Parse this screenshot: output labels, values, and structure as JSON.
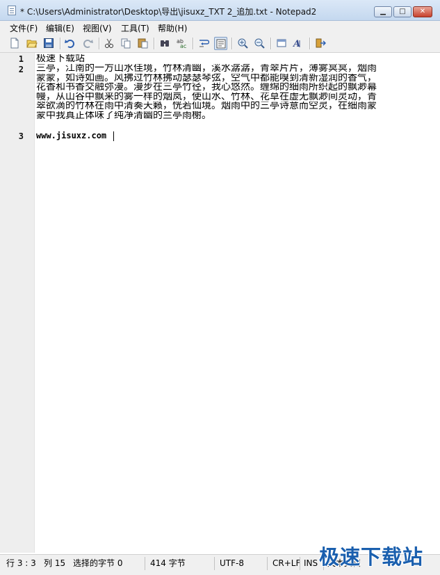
{
  "window": {
    "title": "* C:\\Users\\Administrator\\Desktop\\导出\\jisuxz_TXT 2_追加.txt - Notepad2",
    "minimize_glyph": "▁",
    "maximize_glyph": "□",
    "close_glyph": "✕"
  },
  "menu": {
    "items": [
      "文件(F)",
      "编辑(E)",
      "视图(V)",
      "工具(T)",
      "帮助(H)"
    ]
  },
  "toolbar": {
    "buttons": [
      {
        "icon": "new-file-icon"
      },
      {
        "icon": "open-folder-icon"
      },
      {
        "icon": "save-icon"
      },
      {
        "icon": "undo-icon"
      },
      {
        "icon": "redo-icon"
      },
      {
        "icon": "cut-icon"
      },
      {
        "icon": "copy-icon"
      },
      {
        "icon": "paste-icon"
      },
      {
        "icon": "find-icon"
      },
      {
        "icon": "replace-icon"
      },
      {
        "icon": "word-wrap-icon"
      },
      {
        "icon": "toggle-view-icon",
        "pressed": true
      },
      {
        "icon": "zoom-in-icon"
      },
      {
        "icon": "zoom-out-icon"
      },
      {
        "icon": "scheme-icon"
      },
      {
        "icon": "font-icon"
      },
      {
        "icon": "exit-icon"
      }
    ]
  },
  "editor": {
    "line_numbers": [
      "1",
      "2",
      "3"
    ],
    "line1": "极速下载站",
    "line2_wrapped": [
      "三亭，江南的一方山水佳境，竹林清幽，溪水潺潺，青翠片片，薄雾冥冥，烟雨",
      "蒙蒙，如诗如画。风拂过竹林拂动瑟瑟琴弦，空气中都能嗅到清新湿润的香气，",
      "花香和书香交融弥漫。漫步在三亭竹径，我心悠然。缠绵的细雨所织起的飘渺幕",
      "幔，从山谷中飘来的雾一样的烟岚，使山水、竹林、花草在虚无飘渺间灵动，青",
      "翠欲滴的竹林在雨中清奏天籁，恍若仙境。烟雨中的三亭诗意而空灵，在细雨蒙",
      "蒙中我真正体味了纯净清幽的兰亭雨榭。"
    ],
    "line3": "www.jisuxz.com"
  },
  "status": {
    "position": "行 3 : 3",
    "column": "列 15",
    "selected": "选择的字节 0",
    "bytes": "414 字节",
    "encoding": "UTF-8",
    "eol": "CR+LF",
    "insert_mode": "INS",
    "doc_type": "文本文档"
  },
  "watermark": "极速下载站",
  "colors": {
    "title_gradient_top": "#dbe8f7",
    "title_gradient_bottom": "#c4d8ef",
    "close_button": "#c7412d",
    "gutter": "#eeeeee",
    "watermark": "#1a5fae"
  }
}
